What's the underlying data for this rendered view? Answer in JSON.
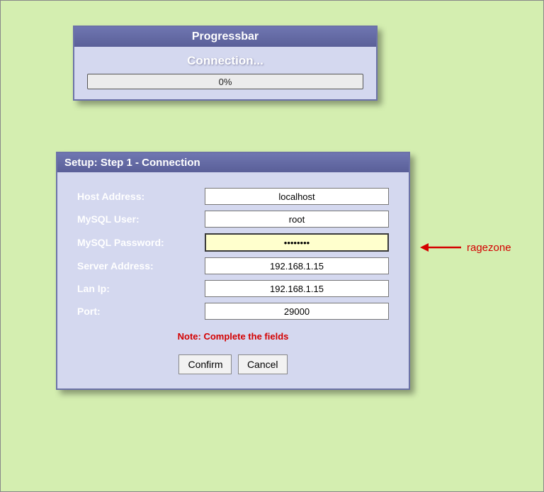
{
  "progressbar": {
    "title": "Progressbar",
    "status": "Connection...",
    "percent_text": "0%"
  },
  "setup": {
    "title": "Setup: Step 1 - Connection",
    "fields": {
      "host_label": "Host Address:",
      "host_value": "localhost",
      "user_label": "MySQL User:",
      "user_value": "root",
      "pass_label": "MySQL Password:",
      "pass_value": "••••••••",
      "server_label": "Server Address:",
      "server_value": "192.168.1.15",
      "lan_label": "Lan Ip:",
      "lan_value": "192.168.1.15",
      "port_label": "Port:",
      "port_value": "29000"
    },
    "note": "Note: Complete the fields",
    "confirm": "Confirm",
    "cancel": "Cancel"
  },
  "annotation": {
    "text": "ragezone"
  }
}
